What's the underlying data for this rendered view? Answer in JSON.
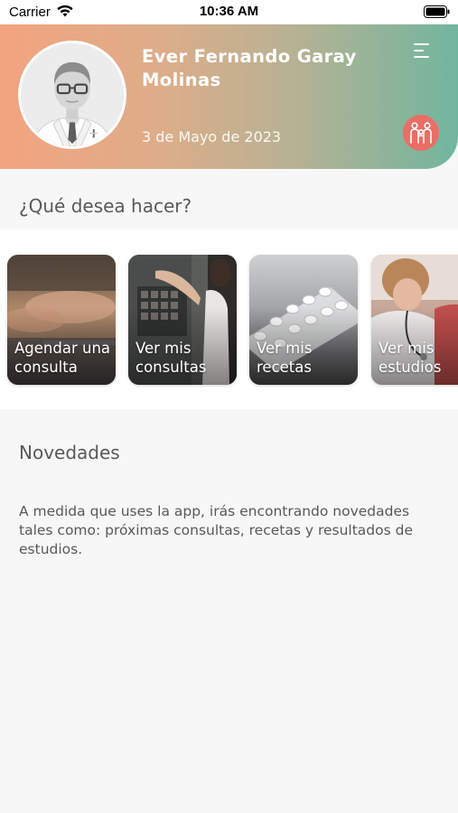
{
  "status_bar": {
    "carrier": "Carrier",
    "time": "10:36 AM",
    "wifi_icon": "wifi-icon",
    "battery_icon": "battery-icon"
  },
  "header": {
    "user_name": "Ever Fernando Garay Molinas",
    "date": "3 de Mayo de 2023",
    "menu_icon": "hamburger-menu-icon",
    "family_icon": "family-icon",
    "gradient_start": "#f3a47f",
    "gradient_end": "#70b69e",
    "family_button_color": "#ea6e67"
  },
  "actions": {
    "title": "¿Qué desea hacer?",
    "cards": [
      {
        "label": "Agendar una consulta",
        "image": "laptop-typing-photo"
      },
      {
        "label": "Ver mis consultas",
        "image": "doctor-consultation-photo"
      },
      {
        "label": "Ver mis recetas",
        "image": "pills-blister-photo"
      },
      {
        "label": "Ver mis estudios",
        "image": "stethoscope-exam-photo"
      }
    ]
  },
  "news": {
    "title": "Novedades",
    "text": "A medida que uses la app, irás encontrando novedades tales como: próximas consultas, recetas y resultados de estudios."
  }
}
